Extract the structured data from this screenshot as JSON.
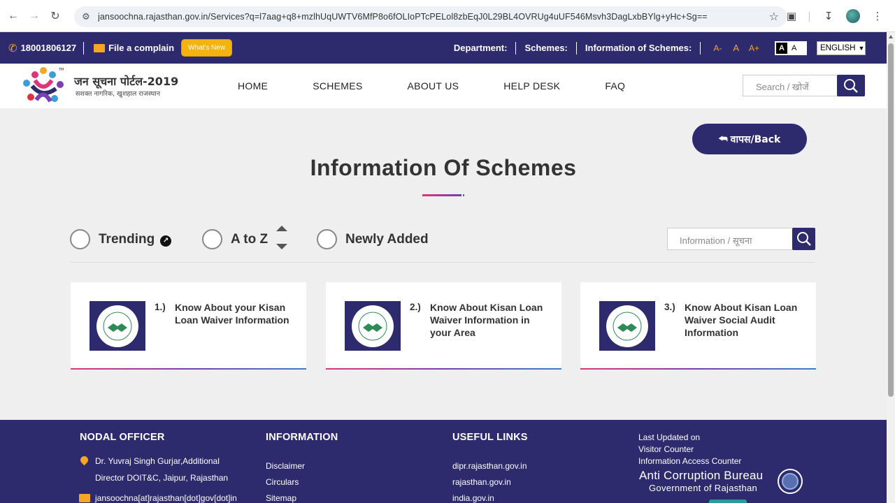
{
  "browser": {
    "url": "jansoochna.rajasthan.gov.in/Services?q=l7aag+q8+mzlhUqUWTV6MfP8o6fOLIoPTcPELol8zbEqJ0L29BL4OVRUg4uUF546Msvh3DagLxbBYlg+yHc+Sg=="
  },
  "topbar": {
    "phone": "18001806127",
    "complain": "File a complain",
    "whats_new": "What's New",
    "department": "Department:",
    "schemes": "Schemes:",
    "info_schemes": "Information of Schemes:",
    "font_small": "A-",
    "font_normal": "A",
    "font_large": "A+",
    "contrast_dark": "A",
    "contrast_light": "A",
    "language": "ENGLISH"
  },
  "header": {
    "logo_title": "जन सूचना पोर्टल-2019",
    "logo_subtitle": "सशक्त नागरिक, खुशहाल राजस्थान",
    "menu": [
      "HOME",
      "SCHEMES",
      "ABOUT US",
      "HELP DESK",
      "FAQ"
    ],
    "search_placeholder": "Search / खोजें"
  },
  "main": {
    "back_button": "वापस/Back",
    "title": "Information Of Schemes",
    "filters": {
      "trending": "Trending",
      "atoz": "A to Z",
      "newly_added": "Newly Added"
    },
    "info_search_placeholder": "Information / सूचना",
    "cards": [
      {
        "num": "1.)",
        "text": "Know About your Kisan Loan Waiver Information"
      },
      {
        "num": "2.)",
        "text": "Know About Kisan Loan Waiver Information in your Area"
      },
      {
        "num": "3.)",
        "text": "Know About Kisan Loan Waiver Social Audit Information"
      }
    ]
  },
  "footer": {
    "nodal_head": "NODAL OFFICER",
    "nodal_line1": "Dr. Yuvraj Singh Gurjar,Additional",
    "nodal_line2": "Director DOIT&C, Jaipur, Rajasthan",
    "nodal_email": "jansoochna[at]rajasthan[dot]gov[dot]in",
    "info_head": "INFORMATION",
    "info_links": [
      "Disclaimer",
      "Circulars",
      "Sitemap"
    ],
    "useful_head": "USEFUL LINKS",
    "useful_links": [
      "dipr.rajasthan.gov.in",
      "rajasthan.gov.in",
      "india.gov.in"
    ],
    "last_updated": "Last Updated on",
    "visitor_counter": "Visitor Counter",
    "access_counter": "Information Access Counter",
    "acb_title": "Anti Corruption Bureau",
    "acb_sub": "Government of Rajasthan"
  },
  "colors": {
    "primary": "#2e2a6e",
    "accent": "#f5a623",
    "background": "#efefef"
  }
}
